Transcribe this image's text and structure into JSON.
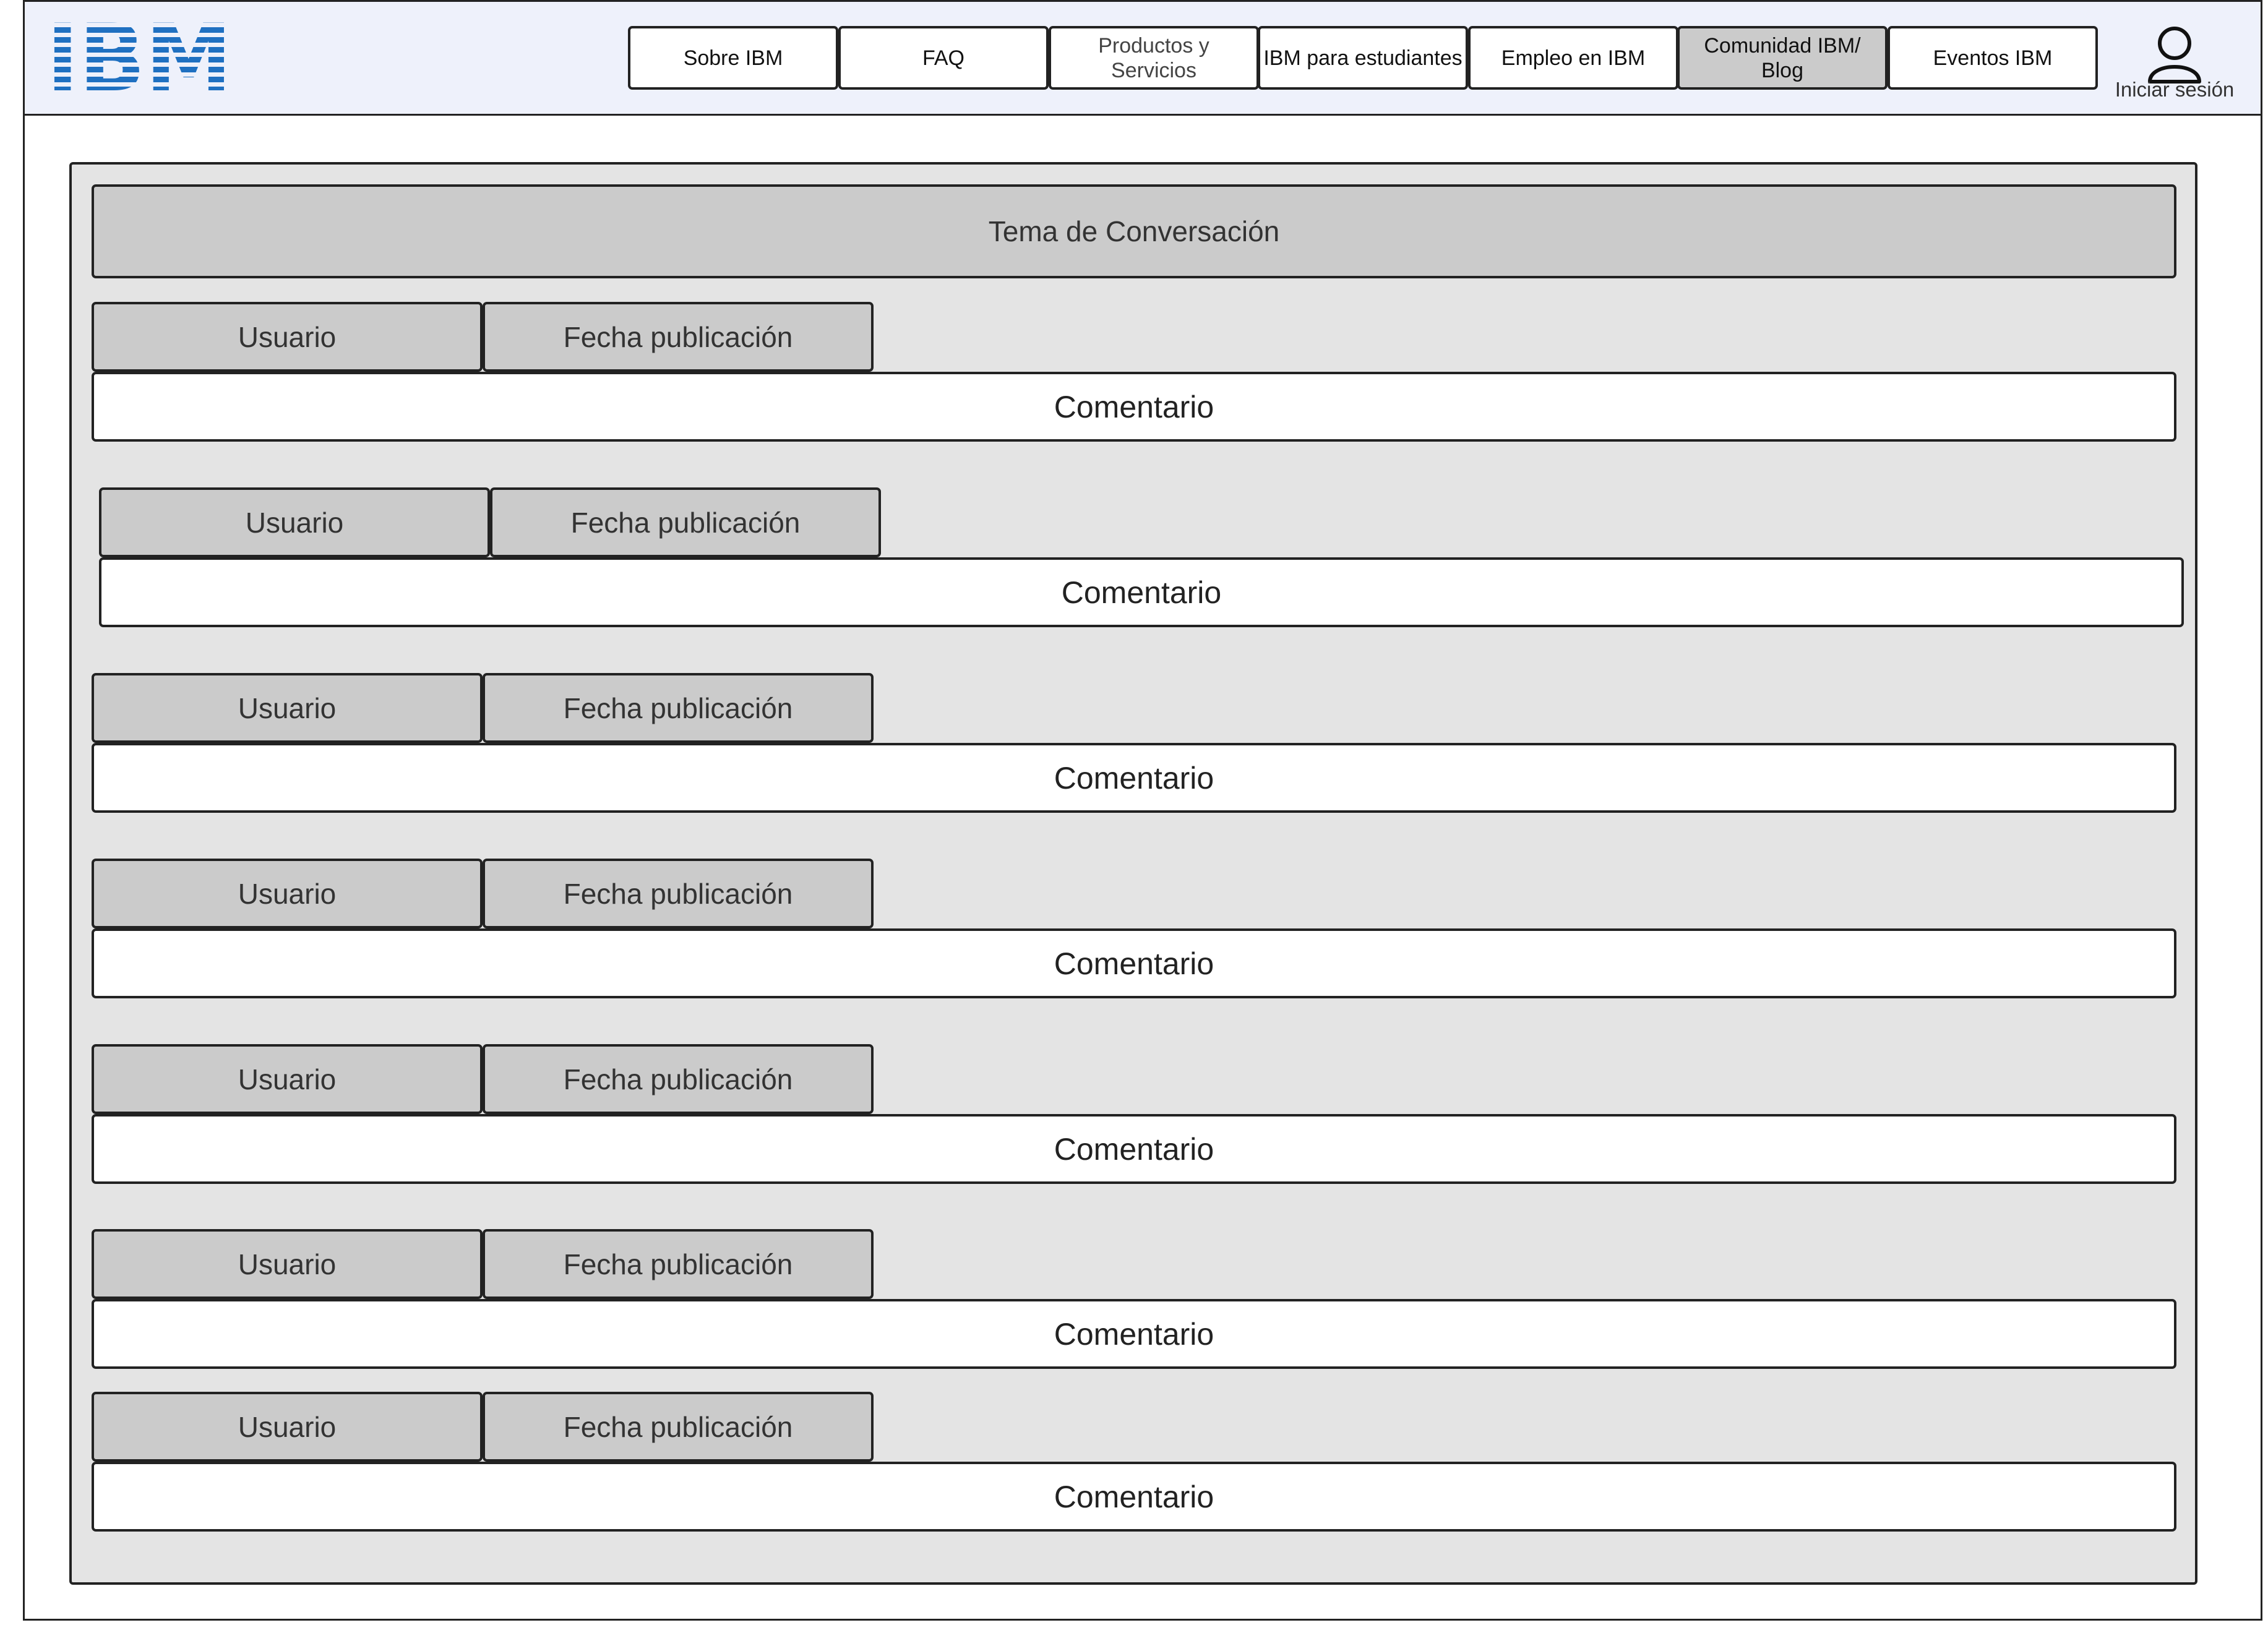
{
  "header": {
    "logo_text": "IBM",
    "logo_color": "#1f70c1",
    "nav": [
      {
        "label": "Sobre IBM",
        "active": false
      },
      {
        "label": "FAQ",
        "active": false
      },
      {
        "label": "Productos y\nServicios",
        "active": false
      },
      {
        "label": "IBM para estudiantes",
        "active": false
      },
      {
        "label": "Empleo en IBM",
        "active": false
      },
      {
        "label": "Comunidad IBM/\nBlog",
        "active": true
      },
      {
        "label": "Eventos IBM",
        "active": false
      }
    ],
    "login": {
      "label": "Iniciar sesión",
      "icon": "user-icon"
    }
  },
  "thread": {
    "topic": "Tema de Conversación",
    "posts": [
      {
        "user": "Usuario",
        "date": "Fecha publicación",
        "comment": "Comentario"
      },
      {
        "user": "Usuario",
        "date": "Fecha publicación",
        "comment": "Comentario"
      },
      {
        "user": "Usuario",
        "date": "Fecha publicación",
        "comment": "Comentario"
      },
      {
        "user": "Usuario",
        "date": "Fecha publicación",
        "comment": "Comentario"
      },
      {
        "user": "Usuario",
        "date": "Fecha publicación",
        "comment": "Comentario"
      },
      {
        "user": "Usuario",
        "date": "Fecha publicación",
        "comment": "Comentario"
      },
      {
        "user": "Usuario",
        "date": "Fecha publicación",
        "comment": "Comentario"
      }
    ]
  }
}
